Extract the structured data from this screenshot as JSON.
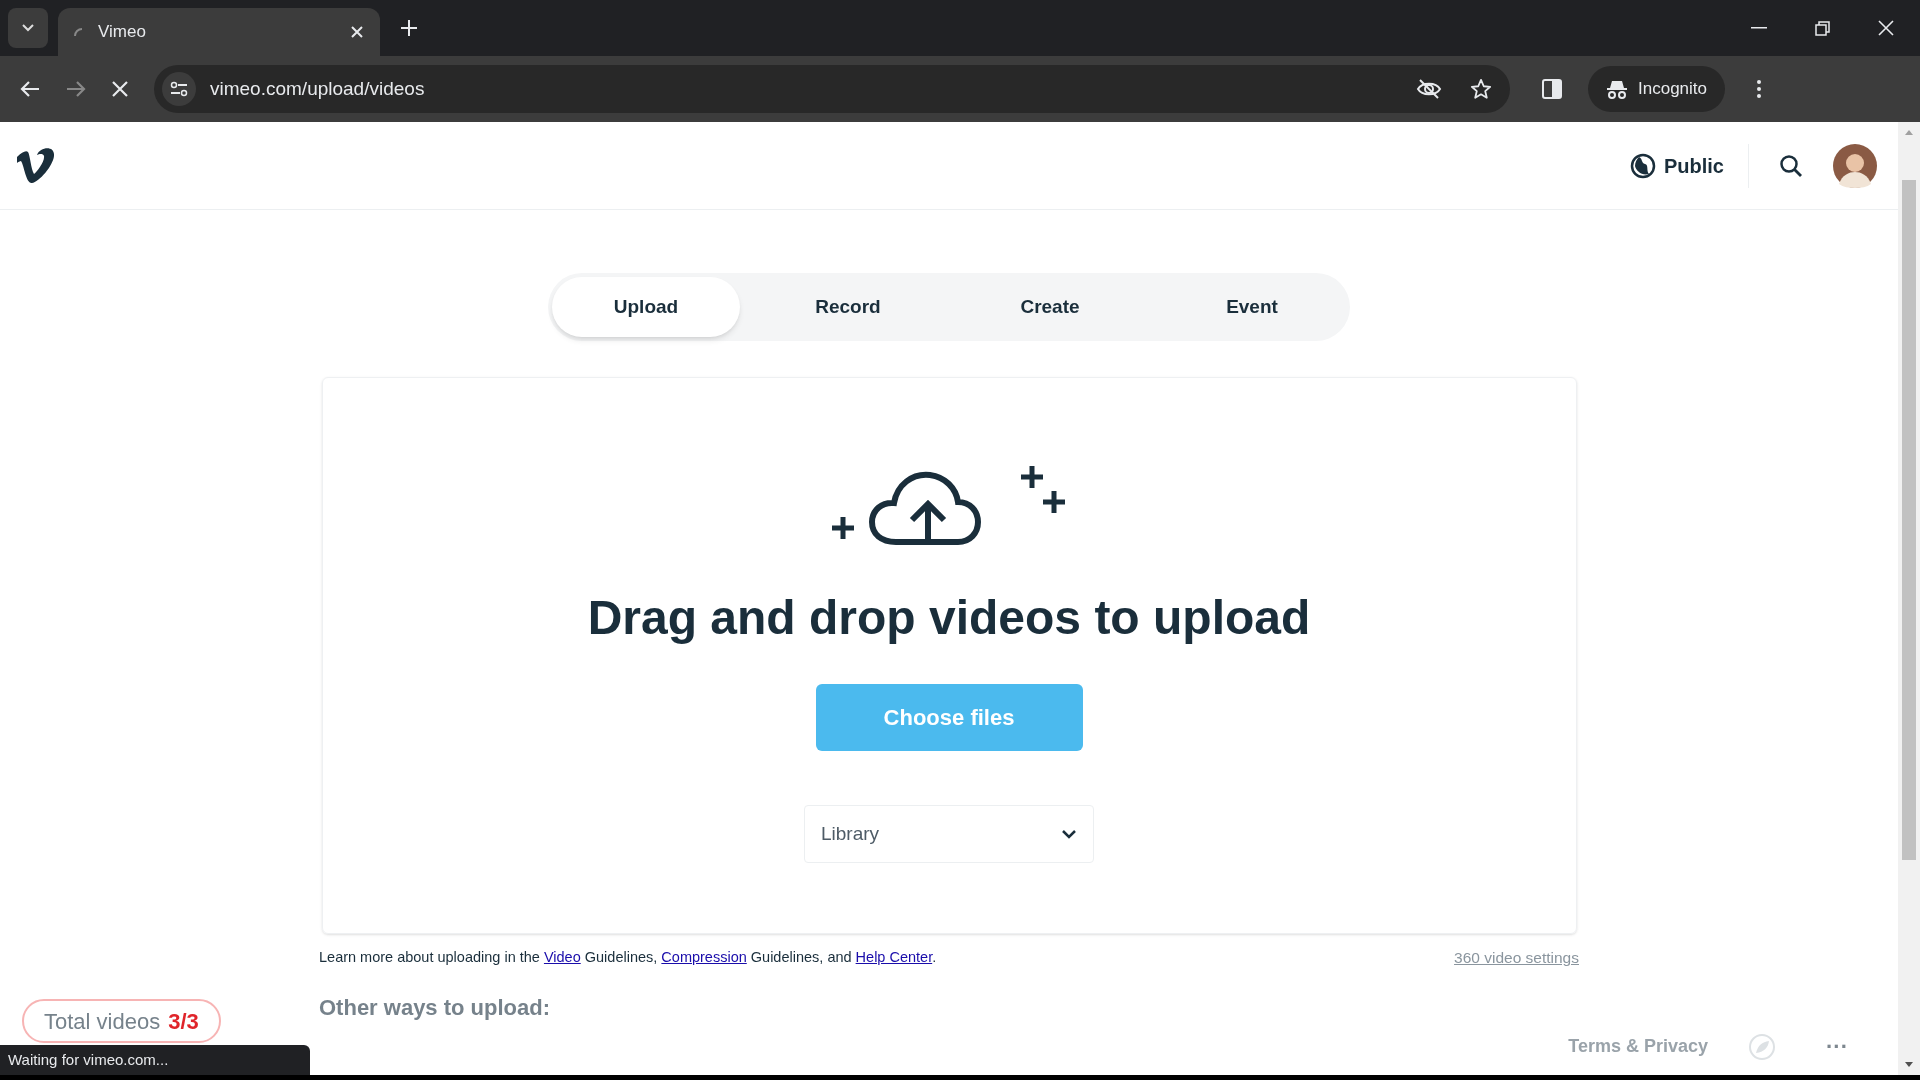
{
  "browser": {
    "tab_title": "Vimeo",
    "url": "vimeo.com/upload/videos",
    "profile_label": "Incognito",
    "status_text": "Waiting for vimeo.com..."
  },
  "header": {
    "privacy_label": "Public"
  },
  "tabs": [
    {
      "label": "Upload",
      "selected": true
    },
    {
      "label": "Record",
      "selected": false
    },
    {
      "label": "Create",
      "selected": false
    },
    {
      "label": "Event",
      "selected": false
    }
  ],
  "dropzone": {
    "heading": "Drag and drop videos to upload",
    "button": "Choose files",
    "destination": "Library"
  },
  "guidelines": [
    {
      "kind": "text",
      "text": "Learn more about uploading in the "
    },
    {
      "kind": "link",
      "text": "Video"
    },
    {
      "kind": "text",
      "text": " Guidelines, "
    },
    {
      "kind": "link",
      "text": "Compression"
    },
    {
      "kind": "text",
      "text": " Guidelines, and "
    },
    {
      "kind": "link",
      "text": "Help Center"
    },
    {
      "kind": "text",
      "text": "."
    }
  ],
  "settings_link": "360 video settings",
  "other_ways_title": "Other ways to upload:",
  "total_videos": {
    "label": "Total videos",
    "count": "3/3"
  },
  "footer": {
    "terms": "Terms & Privacy",
    "more": "···"
  }
}
